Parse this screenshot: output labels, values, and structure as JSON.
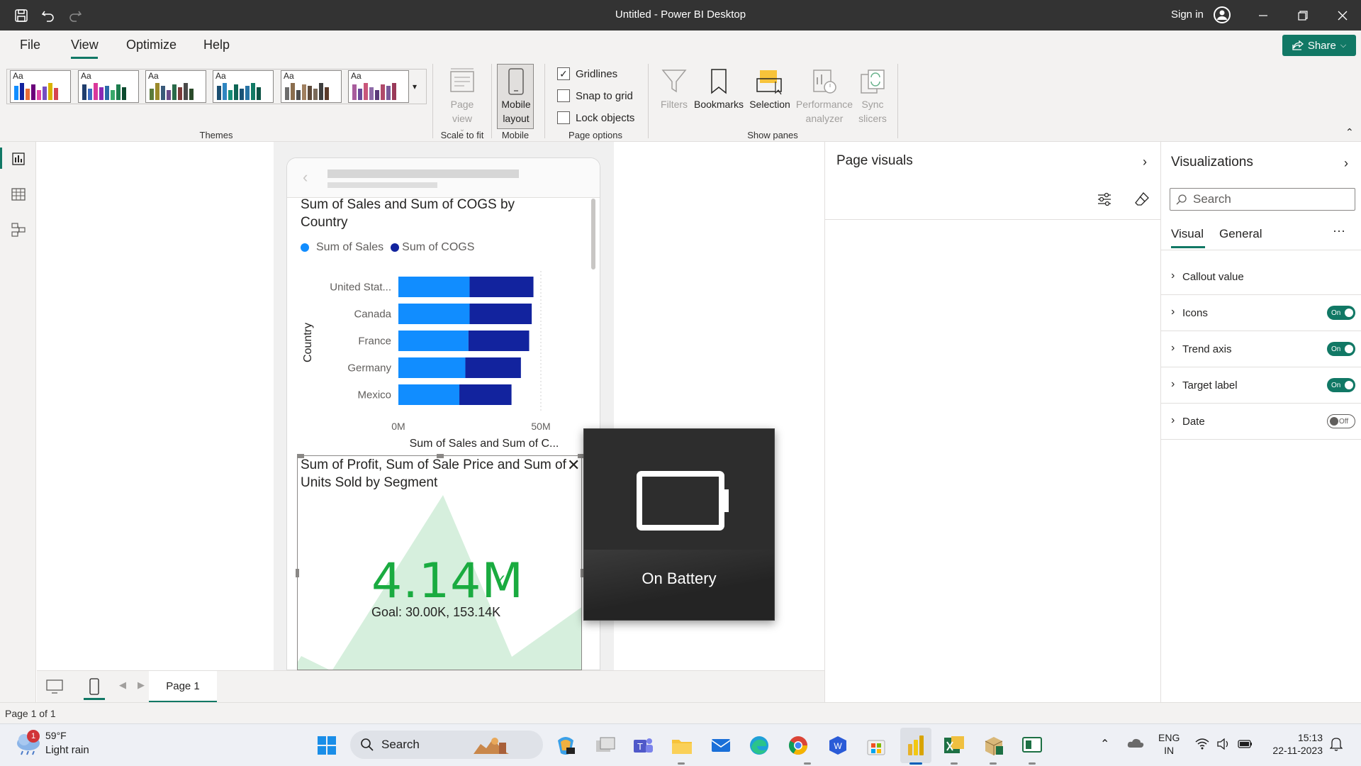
{
  "titlebar": {
    "title": "Untitled - Power BI Desktop",
    "sign_in": "Sign in",
    "save_icon": "save-icon",
    "undo_icon": "undo-icon",
    "redo_icon": "redo-icon"
  },
  "menu": {
    "file": "File",
    "view": "View",
    "optimize": "Optimize",
    "help": "Help",
    "share": "Share"
  },
  "ribbon": {
    "themes_label": "Themes",
    "theme_aa": "Aa",
    "page_view": "Page view",
    "scale_to_fit": "Scale to fit",
    "mobile_layout": "Mobile layout",
    "mobile": "Mobile",
    "gridlines": "Gridlines",
    "snap_to_grid": "Snap to grid",
    "lock_objects": "Lock objects",
    "page_options": "Page options",
    "filters": "Filters",
    "bookmarks": "Bookmarks",
    "selection": "Selection",
    "performance_analyzer": "Performance analyzer",
    "sync_slicers": "Sync slicers",
    "show_panes": "Show panes",
    "gridlines_checked": true,
    "snap_checked": false,
    "lock_checked": false
  },
  "chart1": {
    "title": "Sum of Sales and Sum of COGS by Country",
    "legend_sales": "Sum of  Sales",
    "legend_cogs": "Sum of COGS"
  },
  "chart_data": {
    "type": "bar",
    "orientation": "horizontal",
    "stacked": true,
    "categories": [
      "United Stat...",
      "Canada",
      "France",
      "Germany",
      "Mexico"
    ],
    "series": [
      {
        "name": "Sum of  Sales",
        "color": "#118dff",
        "values": [
          25.0,
          25.0,
          24.6,
          23.5,
          21.4
        ]
      },
      {
        "name": "Sum of COGS",
        "color": "#12239e",
        "values": [
          22.4,
          21.8,
          21.3,
          19.5,
          18.3
        ]
      }
    ],
    "xlabel": "Sum of Sales and Sum of C...",
    "ylabel": "Country",
    "xticks": [
      "0M",
      "50M"
    ],
    "xlim": [
      0,
      50
    ]
  },
  "kpi": {
    "title": "Sum of Profit, Sum of Sale Price and Sum of Units Sold by Segment",
    "value": "4.14M",
    "goal": "Goal: 30.00K, 153.14K",
    "color": "#1aab40"
  },
  "overlay": {
    "label": "On Battery"
  },
  "page_visuals": {
    "title": "Page visuals"
  },
  "visualizations": {
    "title": "Visualizations",
    "search_placeholder": "Search",
    "tab_visual": "Visual",
    "tab_general": "General",
    "more": "···",
    "cards": [
      {
        "label": "Callout value",
        "toggle": null
      },
      {
        "label": "Icons",
        "toggle": "On"
      },
      {
        "label": "Trend axis",
        "toggle": "On"
      },
      {
        "label": "Target label",
        "toggle": "On"
      },
      {
        "label": "Date",
        "toggle": "Off"
      }
    ]
  },
  "pagebar": {
    "page1": "Page 1"
  },
  "status": {
    "page_of": "Page 1 of 1"
  },
  "taskbar": {
    "temp": "59°F",
    "condition": "Light rain",
    "weather_badge": "1",
    "search": "Search",
    "lang_top": "ENG",
    "lang_bottom": "IN",
    "time": "15:13",
    "date": "22-11-2023"
  },
  "colors": {
    "accent": "#117865",
    "sales": "#118dff",
    "cogs": "#12239e"
  }
}
